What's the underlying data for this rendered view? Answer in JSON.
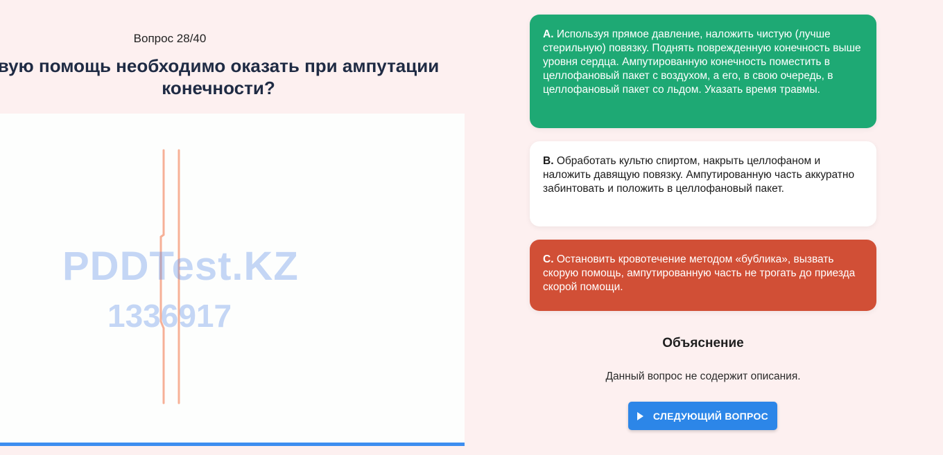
{
  "question": {
    "counter": "Вопрос 28/40",
    "line1": "вую помощь необходимо оказать при ампутации",
    "line2": "конечности?"
  },
  "image": {
    "watermark_brand": "PDDTest.KZ",
    "watermark_id": "1336917"
  },
  "progress": {
    "fraction": 1.0,
    "color": "#3d8ef0"
  },
  "answers": [
    {
      "letter": "A.",
      "text": "Используя прямое давление, наложить чистую (лучше стерильную) повязку. Поднять поврежденную конечность выше уровня сердца. Ампутированную конечность поместить в целлофановый пакет с воздухом, а его, в свою очередь, в целлофановый пакет со льдом. Указать время травмы.",
      "state": "correct",
      "color": "#1ea974"
    },
    {
      "letter": "B.",
      "text": "Обработать культю спиртом, накрыть целлофаном и наложить давящую повязку. Ампутированную часть аккуратно забинтовать и положить в целлофановый пакет.",
      "state": "neutral",
      "color": "#ffffff"
    },
    {
      "letter": "C.",
      "text": "Остановить кровотечение методом «бублика», вызвать скорую помощь, ампутированную часть не трогать до приезда скорой помощи.",
      "state": "wrong",
      "color": "#d14f36"
    }
  ],
  "explanation": {
    "title": "Объяснение",
    "text": "Данный вопрос не содержит описания."
  },
  "next_button": {
    "label": "СЛЕДУЮЩИЙ ВОПРОС",
    "icon": "play-icon"
  }
}
